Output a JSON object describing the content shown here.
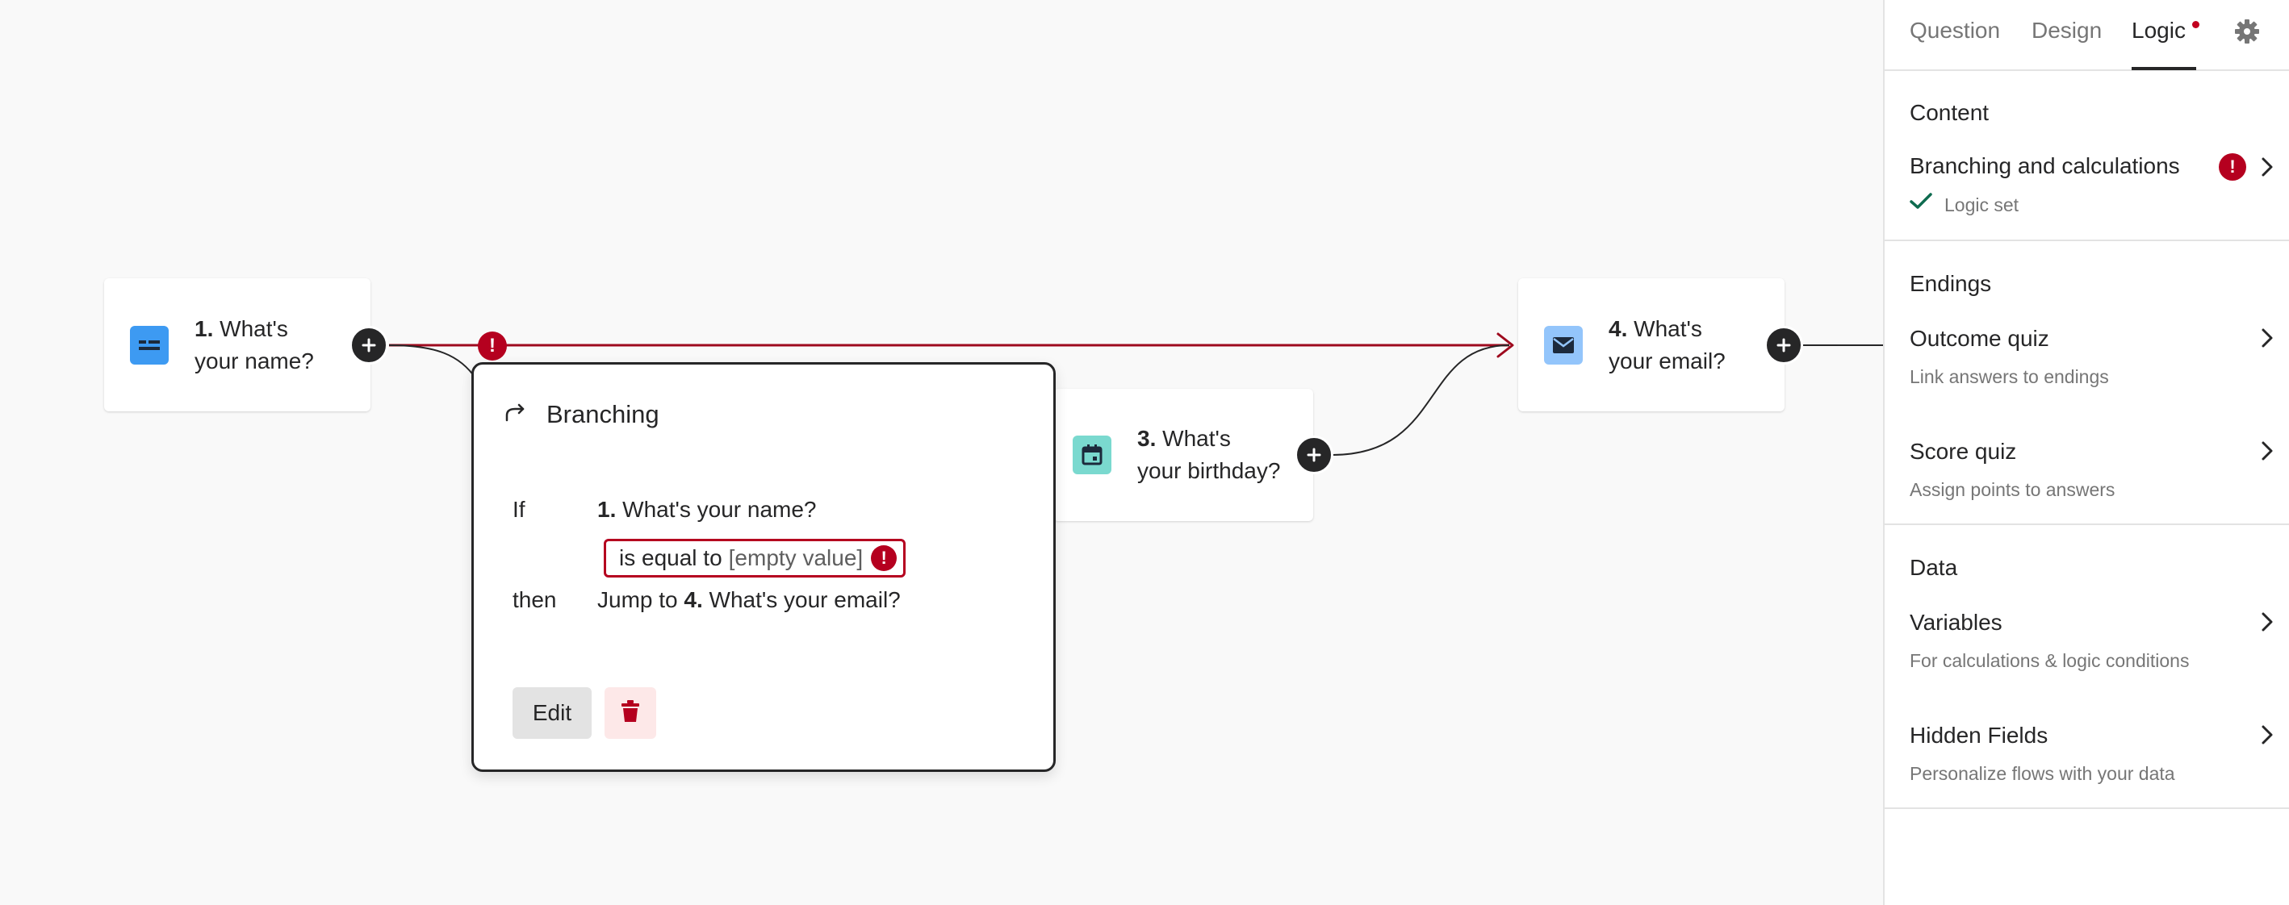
{
  "canvas": {
    "nodes": [
      {
        "number": "1.",
        "line1": "What's",
        "line2": "your name?",
        "icon": "short-text-icon",
        "color": "#3d9af2"
      },
      {
        "number": "3.",
        "line1": "What's",
        "line2": "your birthday?",
        "icon": "calendar-icon",
        "color": "#7ad9cf"
      },
      {
        "number": "4.",
        "line1": "What's",
        "line2": "your email?",
        "icon": "envelope-icon",
        "color": "#93c5fb"
      }
    ],
    "error_glyph": "!",
    "edge_color": "#9e0a1e"
  },
  "popup": {
    "title": "Branching",
    "if_label": "If",
    "question_number": "1.",
    "question_text": "What's your name?",
    "condition_operator": "is equal to",
    "condition_value": "[empty value]",
    "then_label": "then",
    "jump_prefix": "Jump to",
    "jump_number": "4.",
    "jump_text": "What's your email?",
    "edit_label": "Edit"
  },
  "panel": {
    "tabs": [
      {
        "label": "Question",
        "active": false
      },
      {
        "label": "Design",
        "active": false
      },
      {
        "label": "Logic",
        "active": true
      }
    ],
    "content": {
      "title": "Content",
      "item_title": "Branching and calculations",
      "status": "Logic set"
    },
    "endings": {
      "title": "Endings",
      "items": [
        {
          "title": "Outcome quiz",
          "subtitle": "Link answers to endings"
        },
        {
          "title": "Score quiz",
          "subtitle": "Assign points to answers"
        }
      ]
    },
    "data": {
      "title": "Data",
      "items": [
        {
          "title": "Variables",
          "subtitle": "For calculations & logic conditions"
        },
        {
          "title": "Hidden Fields",
          "subtitle": "Personalize flows with your data"
        }
      ]
    }
  },
  "colors": {
    "error": "#b5001f",
    "text": "#262627",
    "muted": "#767676"
  }
}
